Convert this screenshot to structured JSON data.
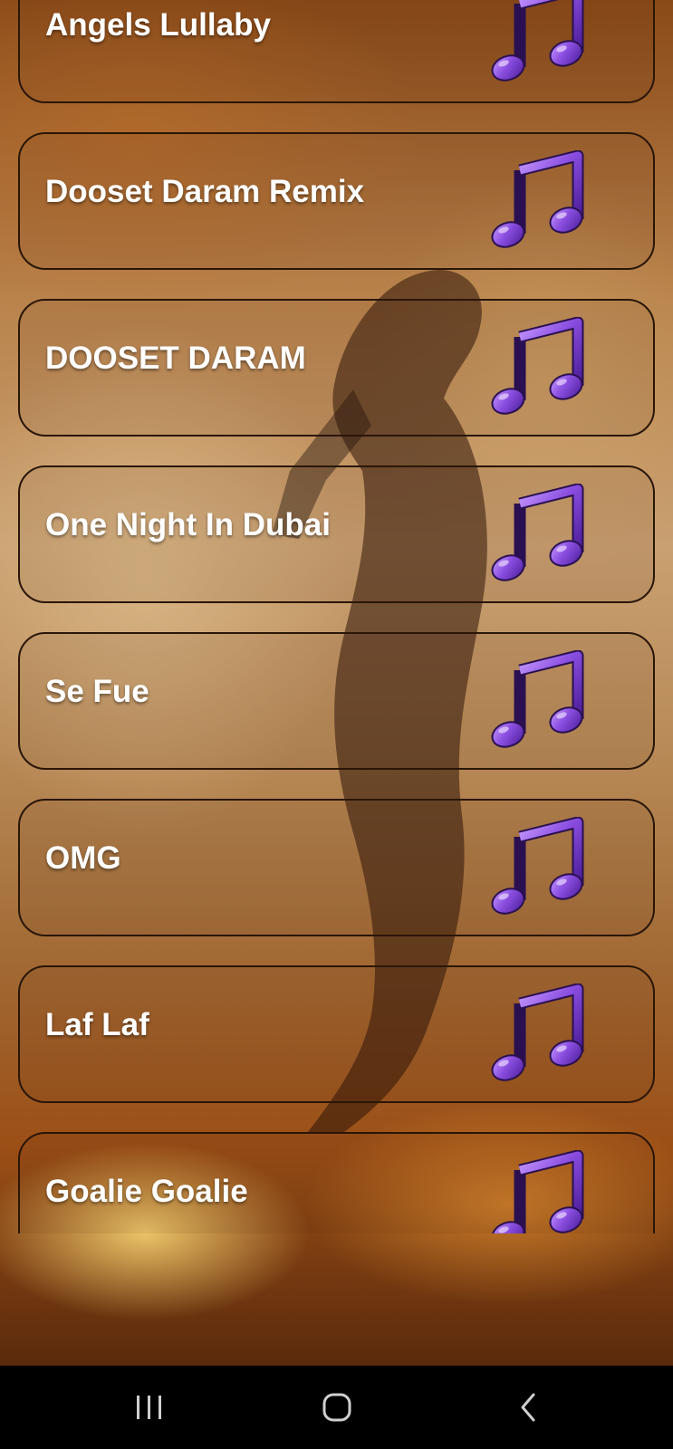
{
  "songs": [
    {
      "title": "Angels Lullaby"
    },
    {
      "title": "Dooset Daram Remix"
    },
    {
      "title": "DOOSET DARAM"
    },
    {
      "title": "One Night In Dubai"
    },
    {
      "title": "Se Fue"
    },
    {
      "title": "OMG"
    },
    {
      "title": "Laf Laf"
    },
    {
      "title": "Goalie Goalie"
    }
  ],
  "icons": {
    "song_icon": "music-note-icon",
    "nav_recent": "recent-apps-icon",
    "nav_home": "home-icon",
    "nav_back": "back-icon"
  },
  "colors": {
    "note_purple": "#7b3fd0",
    "title_text": "#ffffff",
    "card_border": "#2a1608",
    "navbar": "#000000"
  }
}
